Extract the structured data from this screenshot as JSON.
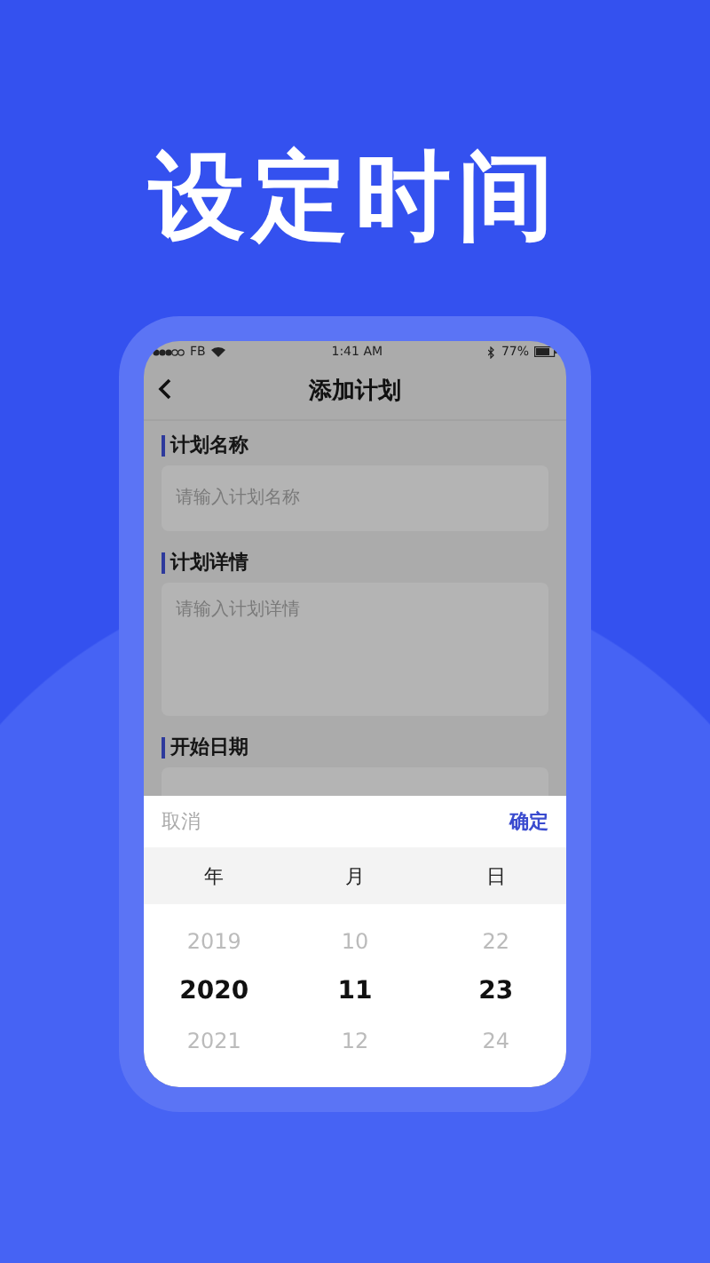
{
  "headline": "设定时间",
  "status_bar": {
    "carrier": "FB",
    "time": "1:41 AM",
    "battery": "77%"
  },
  "nav": {
    "title": "添加计划"
  },
  "fields": [
    {
      "label": "计划名称",
      "kind": "input",
      "placeholder": "请输入计划名称"
    },
    {
      "label": "计划详情",
      "kind": "textarea",
      "placeholder": "请输入计划详情"
    },
    {
      "label": "开始日期",
      "kind": "date"
    }
  ],
  "picker": {
    "cancel": "取消",
    "confirm": "确定",
    "columns": [
      {
        "label": "年",
        "values": [
          {
            "text": "2019",
            "selected": false
          },
          {
            "text": "2020",
            "selected": true
          },
          {
            "text": "2021",
            "selected": false
          }
        ]
      },
      {
        "label": "月",
        "values": [
          {
            "text": "10",
            "selected": false
          },
          {
            "text": "11",
            "selected": true
          },
          {
            "text": "12",
            "selected": false
          }
        ]
      },
      {
        "label": "日",
        "values": [
          {
            "text": "22",
            "selected": false
          },
          {
            "text": "23",
            "selected": true
          },
          {
            "text": "24",
            "selected": false
          }
        ]
      }
    ]
  }
}
